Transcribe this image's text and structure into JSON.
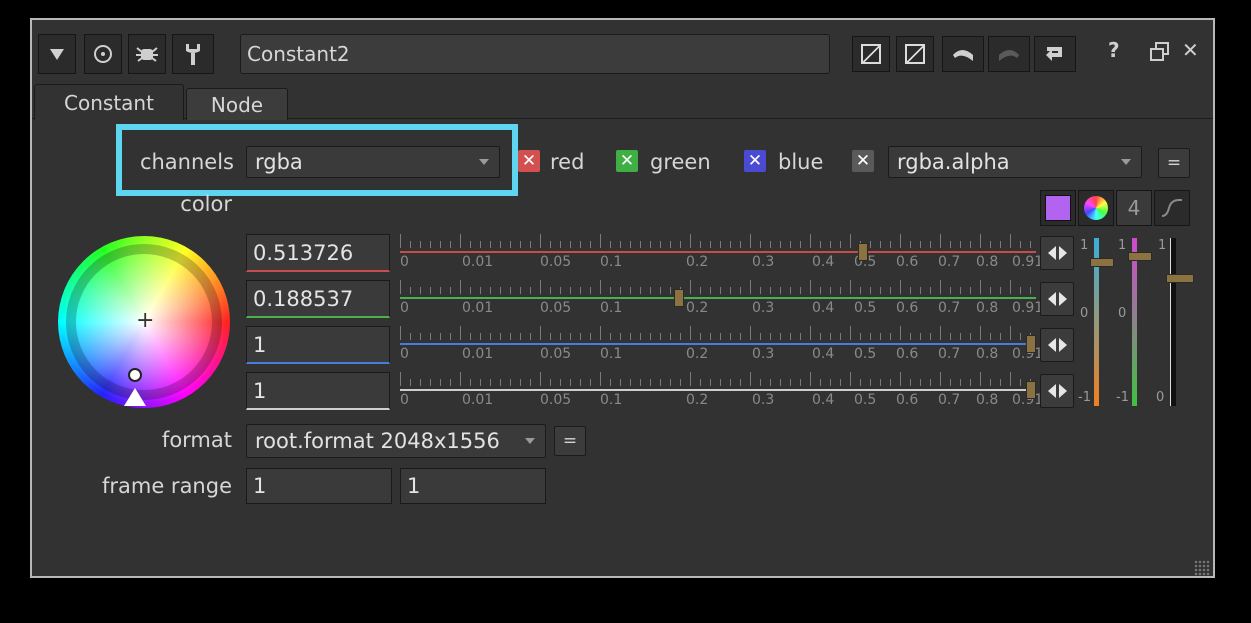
{
  "toolbar": {
    "node_name": "Constant2",
    "collapse_icon": "triangle-down-icon",
    "view_icon": "circle-target-icon",
    "node_icon": "bug-icon",
    "settings_icon": "wrench-icon",
    "help_label": "?",
    "close_label": "✕"
  },
  "tabs": [
    {
      "label": "Constant",
      "active": true
    },
    {
      "label": "Node",
      "active": false
    }
  ],
  "channels": {
    "label": "channels",
    "value": "rgba",
    "checks": [
      {
        "label": "red",
        "color": "#d25050"
      },
      {
        "label": "green",
        "color": "#3fae45"
      },
      {
        "label": "blue",
        "color": "#4a4ad2"
      }
    ],
    "alpha_value": "rgba.alpha",
    "eq_label": "="
  },
  "color": {
    "label": "color",
    "swatch_color": "#b264f0",
    "count_label": "4",
    "fields": [
      {
        "value": "0.513726",
        "channel": "red",
        "line_color": "#c74d4d",
        "pos": 0.513726
      },
      {
        "value": "0.188537",
        "channel": "green",
        "line_color": "#4caf50",
        "pos": 0.188537
      },
      {
        "value": "1",
        "channel": "blue",
        "line_color": "#4b7bd8",
        "pos": 1
      },
      {
        "value": "1",
        "channel": "alpha",
        "line_color": "#cfcfcf",
        "pos": 1
      }
    ],
    "tick_labels": [
      "0",
      "0.01",
      "0.05",
      "0.1",
      "0.2",
      "0.3",
      "0.4",
      "0.5",
      "0.6",
      "0.7",
      "0.8",
      "0.91"
    ],
    "vertical_labels": {
      "top": "1",
      "mid": "0",
      "bottom": "-1"
    }
  },
  "format": {
    "label": "format",
    "value": "root.format 2048x1556",
    "eq_label": "="
  },
  "frame_range": {
    "label": "frame range",
    "start": "1",
    "end": "1"
  }
}
